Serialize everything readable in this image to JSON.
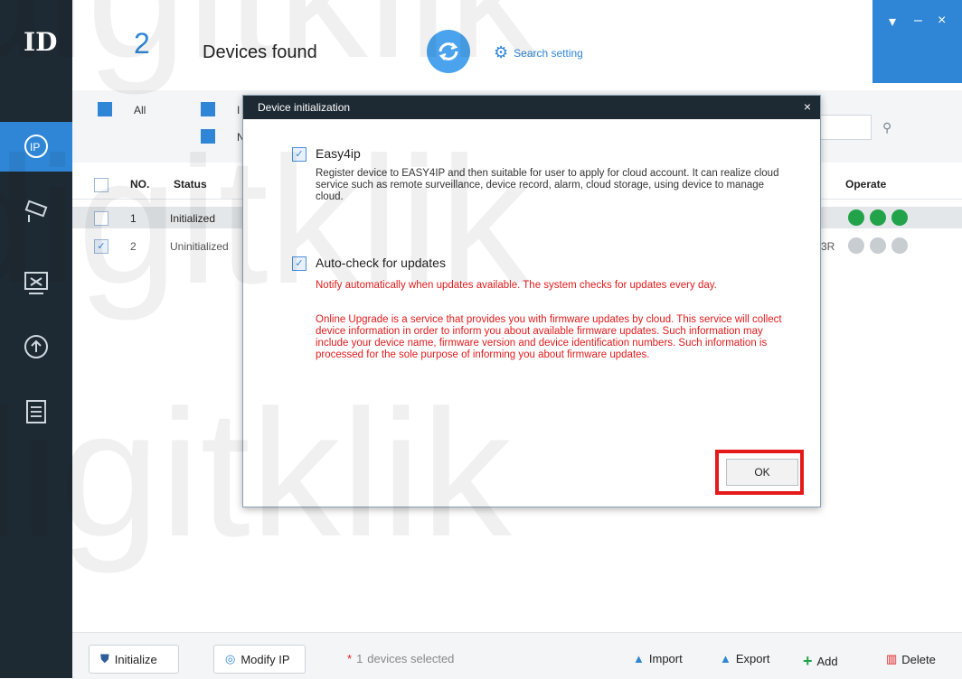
{
  "app": {
    "logo_text": "ID"
  },
  "header": {
    "device_count": "2",
    "devices_found_label": "Devices found",
    "search_setting_label": "Search setting"
  },
  "window_controls": {
    "menu": "▾",
    "minimize": "–",
    "close": "×"
  },
  "sidebar": {
    "items": [
      {
        "name": "ip",
        "icon": "ip-icon",
        "active": true
      },
      {
        "name": "camera",
        "icon": "camera-icon",
        "active": false
      },
      {
        "name": "tools",
        "icon": "tools-icon",
        "active": false
      },
      {
        "name": "upgrade",
        "icon": "upload-icon",
        "active": false
      },
      {
        "name": "docs",
        "icon": "document-icon",
        "active": false
      }
    ]
  },
  "filters": {
    "all_label": "All",
    "ip_label": "I",
    "n_label": "N"
  },
  "table": {
    "headers": {
      "no": "NO.",
      "status": "Status",
      "operate": "Operate"
    },
    "rows": [
      {
        "no": "1",
        "status": "Initialized",
        "extra": "",
        "selected": false
      },
      {
        "no": "2",
        "status": "Uninitialized",
        "extra": "3R",
        "selected": true
      }
    ]
  },
  "footer": {
    "initialize_label": "Initialize",
    "modify_ip_label": "Modify IP",
    "selected_count": "1",
    "selected_text": "devices selected",
    "import_label": "Import",
    "export_label": "Export",
    "add_label": "Add",
    "delete_label": "Delete"
  },
  "modal": {
    "title": "Device initialization",
    "close": "×",
    "easy4ip": {
      "label": "Easy4ip",
      "checked": true,
      "description": "Register device to EASY4IP and then suitable for user to apply for cloud account. It can realize cloud service such as remote surveillance, device record, alarm, cloud storage, using device to manage cloud."
    },
    "autocheck": {
      "label": "Auto-check for updates",
      "checked": true,
      "notify": "Notify automatically when updates available. The system checks for updates every day.",
      "online": "Online Upgrade is a service that provides you with firmware updates by cloud. This service will collect device information in order to inform you about available firmware updates. Such information may include your device name, firmware version and device identification numbers. Such information is processed for the sole purpose of informing you about firmware updates."
    },
    "ok_label": "OK"
  },
  "colors": {
    "accent": "#2f86d6",
    "sidebar": "#1e2a33",
    "highlight": "#e41a1a",
    "warning_text": "#e01a1a"
  },
  "watermark": "digitklik"
}
